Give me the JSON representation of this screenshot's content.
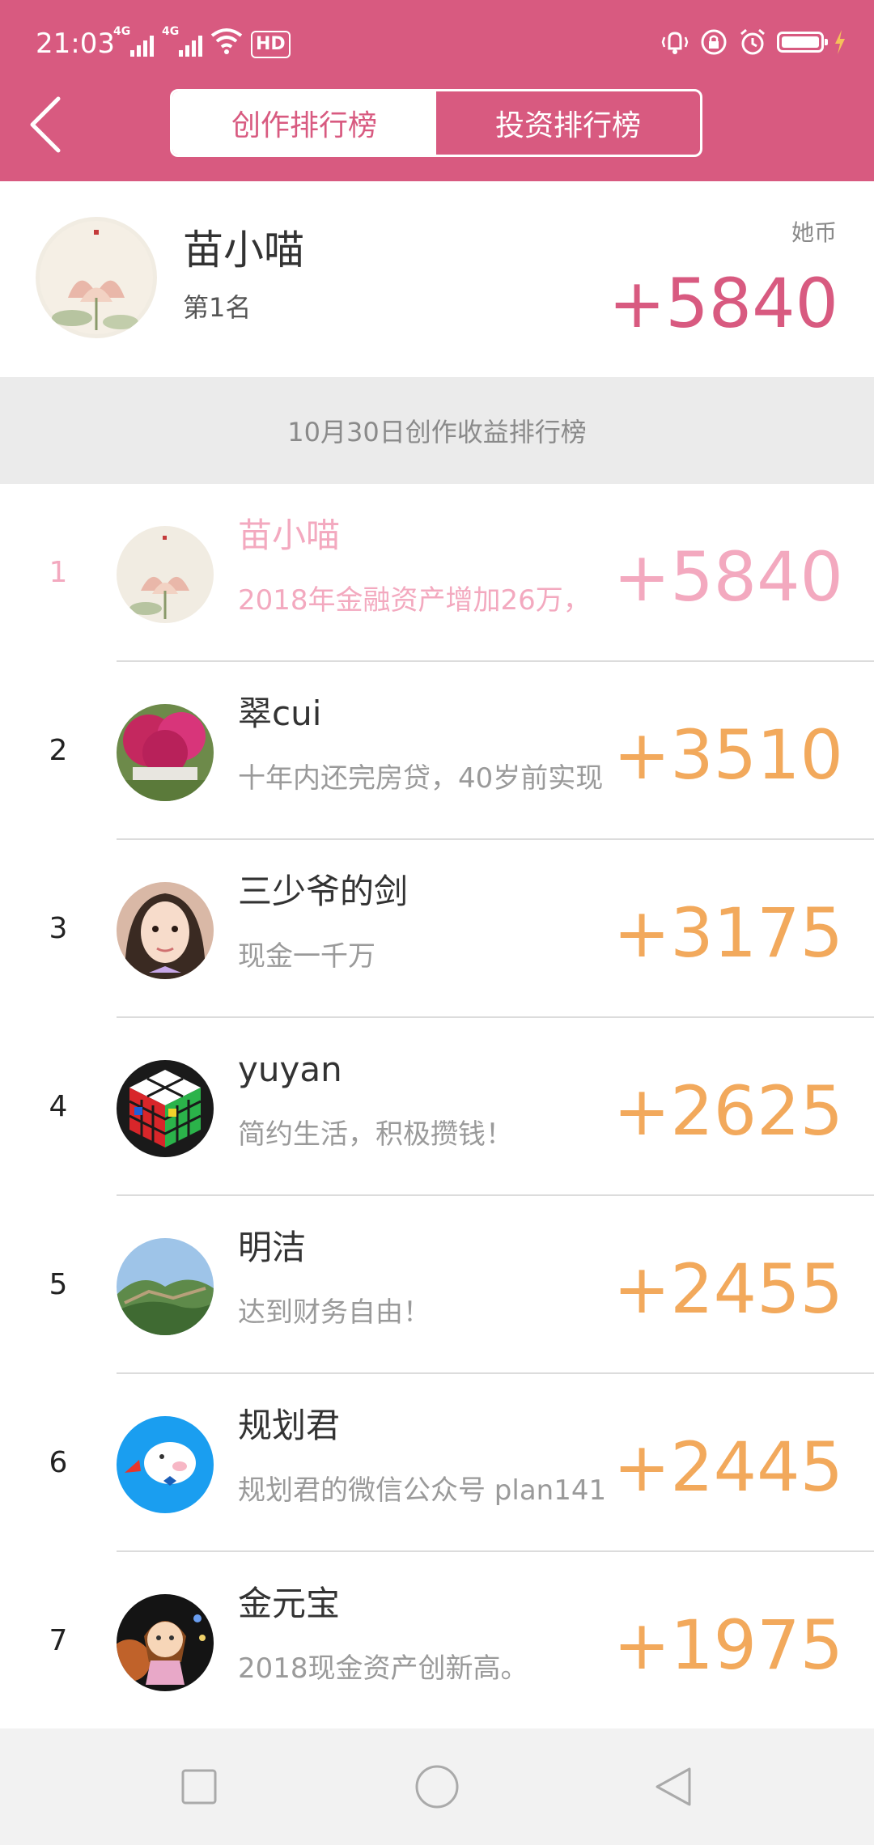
{
  "status_bar": {
    "time": "21:03",
    "network_1": "4G",
    "network_2": "4G",
    "hd_label": "HD"
  },
  "nav": {
    "tabs": [
      {
        "label": "创作排行榜",
        "active": true
      },
      {
        "label": "投资排行榜",
        "active": false
      }
    ]
  },
  "my_rank": {
    "name": "苗小喵",
    "rank_label": "第1名",
    "currency_label": "她币",
    "score": "+5840"
  },
  "section_title": "10月30日创作收益排行榜",
  "ranking": [
    {
      "rank": "1",
      "name": "苗小喵",
      "motto": "2018年金融资产增加26万，",
      "score": "+5840",
      "is_me": true
    },
    {
      "rank": "2",
      "name": "翠cui",
      "motto": "十年内还完房贷，40岁前实现",
      "score": "+3510",
      "is_me": false
    },
    {
      "rank": "3",
      "name": "三少爷的剑",
      "motto": "现金一千万",
      "score": "+3175",
      "is_me": false
    },
    {
      "rank": "4",
      "name": "yuyan",
      "motto": "简约生活，积极攒钱！",
      "score": "+2625",
      "is_me": false
    },
    {
      "rank": "5",
      "name": "明洁",
      "motto": "达到财务自由！",
      "score": "+2455",
      "is_me": false
    },
    {
      "rank": "6",
      "name": "规划君",
      "motto": "规划君的微信公众号 plan141",
      "score": "+2445",
      "is_me": false
    },
    {
      "rank": "7",
      "name": "金元宝",
      "motto": "2018现金资产创新高。",
      "score": "+1975",
      "is_me": false
    }
  ],
  "colors": {
    "brand": "#d85a80",
    "score": "#f2a95c",
    "self_highlight": "#f3a9bf"
  }
}
